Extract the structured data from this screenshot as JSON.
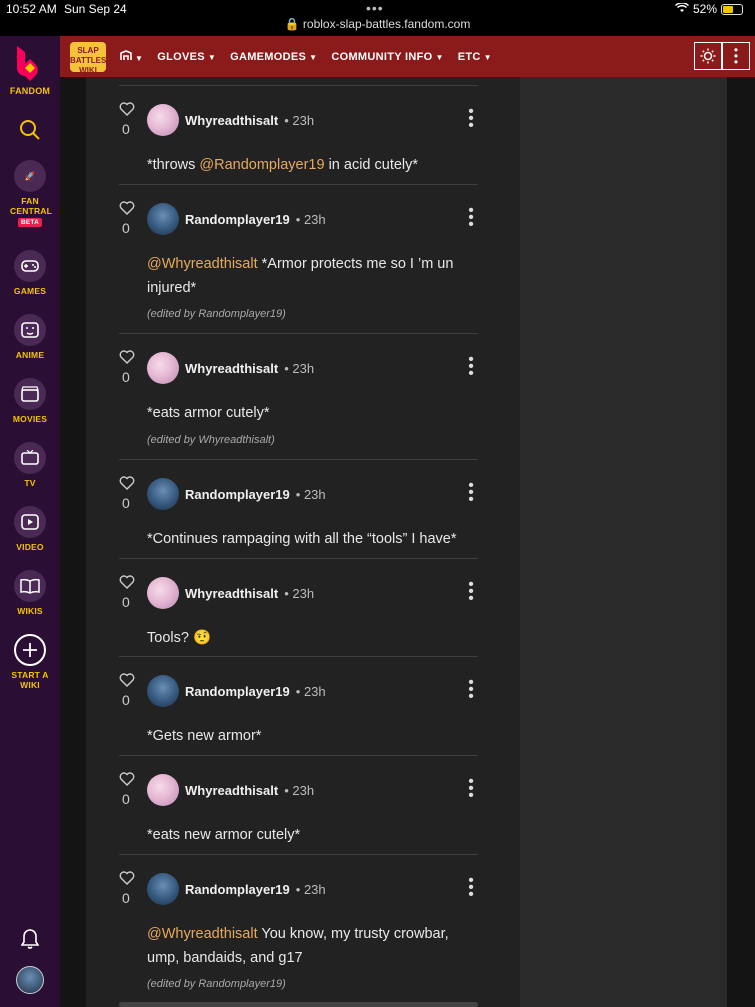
{
  "status_bar": {
    "time": "10:52 AM",
    "date": "Sun Sep 24",
    "url": "roblox-slap-battles.fandom.com",
    "battery": "52%"
  },
  "rail": {
    "brand": "FANDOM",
    "items": [
      {
        "label": "FAN CENTRAL",
        "badge": "BETA",
        "icon": "rocket-icon"
      },
      {
        "label": "GAMES",
        "icon": "gamepad-icon"
      },
      {
        "label": "ANIME",
        "icon": "anime-face-icon"
      },
      {
        "label": "MOVIES",
        "icon": "clapperboard-icon"
      },
      {
        "label": "TV",
        "icon": "tv-icon"
      },
      {
        "label": "VIDEO",
        "icon": "play-icon"
      },
      {
        "label": "WIKIS",
        "icon": "book-icon"
      },
      {
        "label": "START A WIKI",
        "icon": "plus-icon"
      }
    ]
  },
  "wiki_header": {
    "logo_text": "SLAP BATTLES WIKI",
    "nav": [
      "GLOVES",
      "GAMEMODES",
      "COMMUNITY INFO",
      "ETC"
    ]
  },
  "comments": [
    {
      "user": "Whyreadthisalt",
      "time": "23h",
      "likes": "0",
      "mention": "@Randomplayer19",
      "pre": "*throws ",
      "text": " in acid cutely*",
      "edited": ""
    },
    {
      "user": "Randomplayer19",
      "time": "23h",
      "likes": "0",
      "mention": "@Whyreadthisalt",
      "pre": "",
      "text": " *Armor protects me so I ’m un injured*",
      "edited": "(edited by Randomplayer19)"
    },
    {
      "user": "Whyreadthisalt",
      "time": "23h",
      "likes": "0",
      "mention": "",
      "pre": "",
      "text": "*eats armor cutely*",
      "edited": "(edited by Whyreadthisalt)"
    },
    {
      "user": "Randomplayer19",
      "time": "23h",
      "likes": "0",
      "mention": "",
      "pre": "",
      "text": "*Continues rampaging with all the “tools” I have*",
      "edited": ""
    },
    {
      "user": "Whyreadthisalt",
      "time": "23h",
      "likes": "0",
      "mention": "",
      "pre": "",
      "text": "Tools? 🤨",
      "edited": ""
    },
    {
      "user": "Randomplayer19",
      "time": "23h",
      "likes": "0",
      "mention": "",
      "pre": "",
      "text": "*Gets new armor*",
      "edited": ""
    },
    {
      "user": "Whyreadthisalt",
      "time": "23h",
      "likes": "0",
      "mention": "",
      "pre": "",
      "text": "*eats new armor cutely*",
      "edited": ""
    },
    {
      "user": "Randomplayer19",
      "time": "23h",
      "likes": "0",
      "mention": "@Whyreadthisalt",
      "pre": "",
      "text": " You know, my trusty crowbar, ump, bandaids, and g17",
      "edited": "(edited by Randomplayer19)"
    }
  ]
}
